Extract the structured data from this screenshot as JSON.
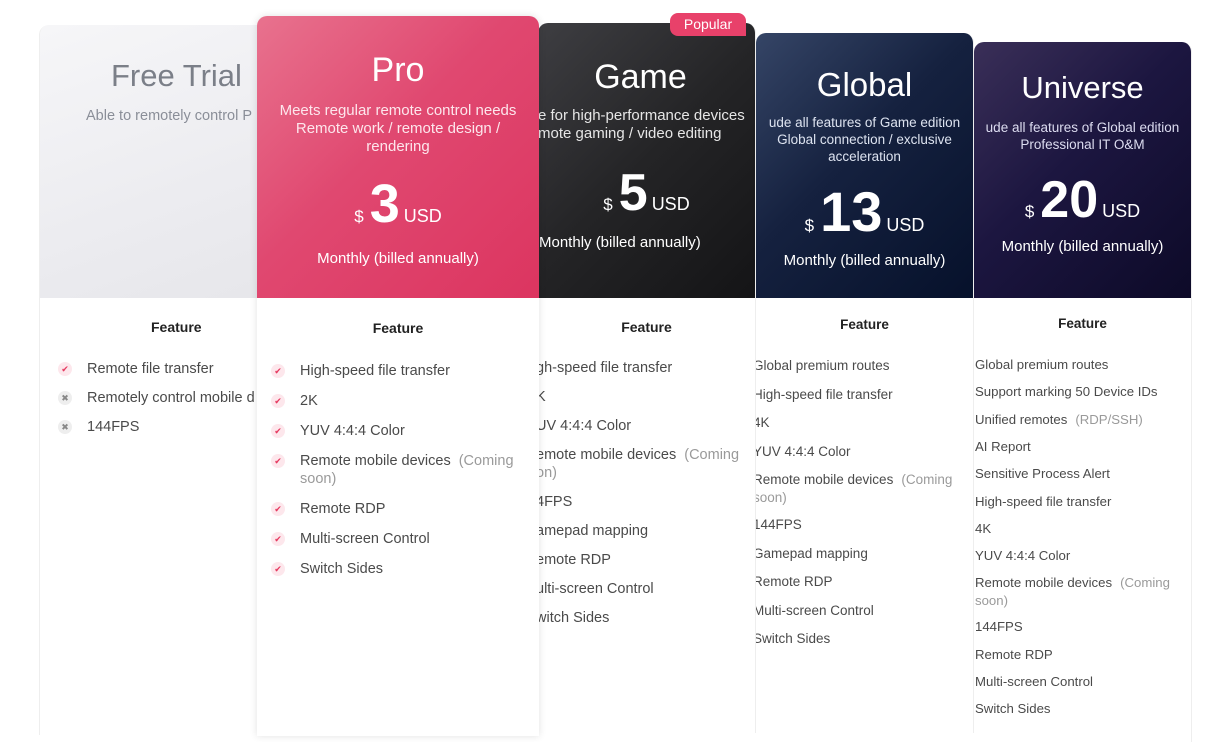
{
  "popular_badge": "Popular",
  "feature_heading": "Feature",
  "plans": {
    "free": {
      "name": "Free Trial",
      "desc": [
        "Able to remotely control P"
      ],
      "features": [
        {
          "icon": "check",
          "text": "Remote file transfer"
        },
        {
          "icon": "cross",
          "text": "Remotely control mobile d"
        },
        {
          "icon": "cross",
          "text": "144FPS"
        }
      ]
    },
    "pro": {
      "name": "Pro",
      "desc": [
        "Meets regular remote control needs",
        "Remote work / remote design /",
        "rendering"
      ],
      "currency": "$",
      "amount": "3",
      "unit": "USD",
      "billing": "Monthly (billed annually)",
      "features": [
        {
          "icon": "check",
          "text": "High-speed file transfer"
        },
        {
          "icon": "check",
          "text": "2K"
        },
        {
          "icon": "check",
          "text": "YUV 4:4:4 Color"
        },
        {
          "icon": "check",
          "text": "Remote mobile devices",
          "note": "(Coming",
          "line2": "soon)"
        },
        {
          "icon": "check",
          "text": "Remote RDP"
        },
        {
          "icon": "check",
          "text": "Multi-screen Control"
        },
        {
          "icon": "check",
          "text": "Switch Sides"
        }
      ]
    },
    "game": {
      "name": "Game",
      "desc": [
        "e for high-performance devices",
        "mote gaming / video editing"
      ],
      "currency": "$",
      "amount": "5",
      "unit": "USD",
      "billing": "Monthly (billed annually)",
      "features": [
        {
          "text": "gh-speed file transfer"
        },
        {
          "text": "K"
        },
        {
          "text": "UV 4:4:4 Color"
        },
        {
          "text": "emote mobile devices",
          "note": "(Coming",
          "line2": "on)"
        },
        {
          "text": "4FPS"
        },
        {
          "text": "amepad mapping"
        },
        {
          "text": "emote RDP"
        },
        {
          "text": "ulti-screen Control"
        },
        {
          "text": "witch Sides"
        }
      ]
    },
    "global": {
      "name": "Global",
      "desc": [
        "ude all features of Game edition",
        "Global connection / exclusive",
        "acceleration"
      ],
      "currency": "$",
      "amount": "13",
      "unit": "USD",
      "billing": "Monthly (billed annually)",
      "features": [
        {
          "text": "Global premium routes"
        },
        {
          "text": "High-speed file transfer"
        },
        {
          "text": "4K"
        },
        {
          "text": "YUV 4:4:4 Color"
        },
        {
          "text": "Remote mobile devices",
          "note": "(Coming",
          "line2": "soon)"
        },
        {
          "text": "144FPS"
        },
        {
          "text": "Gamepad mapping"
        },
        {
          "text": "Remote RDP"
        },
        {
          "text": "Multi-screen Control"
        },
        {
          "text": "Switch Sides"
        }
      ]
    },
    "universe": {
      "name": "Universe",
      "desc": [
        "ude all features of Global edition",
        "Professional IT O&M"
      ],
      "currency": "$",
      "amount": "20",
      "unit": "USD",
      "billing": "Monthly (billed annually)",
      "features": [
        {
          "text": "Global premium routes"
        },
        {
          "text": "Support marking 50 Device IDs"
        },
        {
          "text": "Unified remotes",
          "note": "(RDP/SSH)"
        },
        {
          "text": "AI Report"
        },
        {
          "text": "Sensitive Process Alert"
        },
        {
          "text": "High-speed file transfer"
        },
        {
          "text": "4K"
        },
        {
          "text": "YUV 4:4:4 Color"
        },
        {
          "text": "Remote mobile devices",
          "note": "(Coming",
          "line2": "soon)"
        },
        {
          "text": "144FPS"
        },
        {
          "text": "Remote RDP"
        },
        {
          "text": "Multi-screen Control"
        },
        {
          "text": "Switch Sides"
        }
      ]
    }
  }
}
